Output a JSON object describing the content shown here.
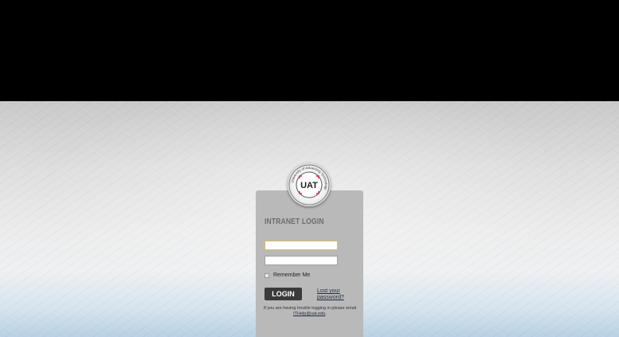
{
  "login": {
    "title": "INTRANET LOGIN",
    "username_value": "",
    "password_value": "",
    "remember_label": "Remember Me",
    "remember_checked": false,
    "button_label": "LOGIN",
    "lost_password_label": "Lost your password?",
    "trouble_text": "If you are having trouble logging in please email",
    "trouble_email": "ITHelp@uat.edu",
    "trouble_suffix": "."
  },
  "logo": {
    "initials": "UAT",
    "ring_text": "University of Advancing Technology",
    "ring_tagline": "Learn Experience Innovate",
    "accent_color": "#c8102e"
  },
  "colors": {
    "top_band": "#000000",
    "panel": "#b9b9b9",
    "button": "#3a3a3a"
  }
}
